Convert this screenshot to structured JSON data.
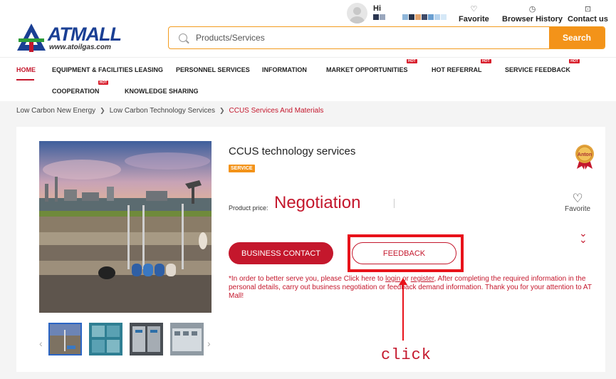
{
  "header": {
    "logo_text": "ATMALL",
    "logo_url": "www.atoilgas.com",
    "greeting": "Hi",
    "top_links": [
      {
        "label": "Favorite",
        "icon": "heart-icon"
      },
      {
        "label": "Browser History",
        "icon": "clock-icon"
      },
      {
        "label": "Contact us",
        "icon": "contact-icon"
      }
    ],
    "search": {
      "placeholder": "Products/Services",
      "button_label": "Search"
    }
  },
  "nav": {
    "items": [
      {
        "label": "HOME",
        "active": true,
        "hot": false
      },
      {
        "label": "EQUIPMENT & FACILITIES LEASING",
        "hot": false
      },
      {
        "label": "PERSONNEL SERVICES",
        "hot": false
      },
      {
        "label": "INFORMATION",
        "hot": false
      },
      {
        "label": "MARKET OPPORTUNITIES",
        "hot": true
      },
      {
        "label": "HOT REFERRAL",
        "hot": true
      },
      {
        "label": "SERVICE FEEDBACK",
        "hot": true
      },
      {
        "label": "COOPERATION",
        "hot": true
      },
      {
        "label": "KNOWLEDGE SHARING",
        "hot": false
      }
    ],
    "hot_badge": "HOT"
  },
  "breadcrumb": [
    "Low Carbon New Energy",
    "Low Carbon Technology Services",
    "CCUS Services And Materials"
  ],
  "product": {
    "title": "CCUS technology services",
    "tag": "SERVICE",
    "price_label": "Product price:",
    "price_value": "Negotiation",
    "badge_text": "Anton",
    "favorite_label": "Favorite",
    "business_contact_label": "BUSINESS CONTACT",
    "feedback_label": "FEEDBACK",
    "notice_parts": {
      "before": "*In order to better serve you, please Click here to ",
      "login": "login",
      "or": " or ",
      "register": "register",
      "after": ", After completing the required information in the personal details, carry out business negotiation or feedback demand information. Thank you for your attention to AT Mall!"
    }
  },
  "annotation": {
    "click_label": "click"
  },
  "colors": {
    "brand_red": "#c4172c",
    "search_orange": "#f39319",
    "highlight_red": "#e8121a",
    "logo_blue": "#1a3f94"
  }
}
